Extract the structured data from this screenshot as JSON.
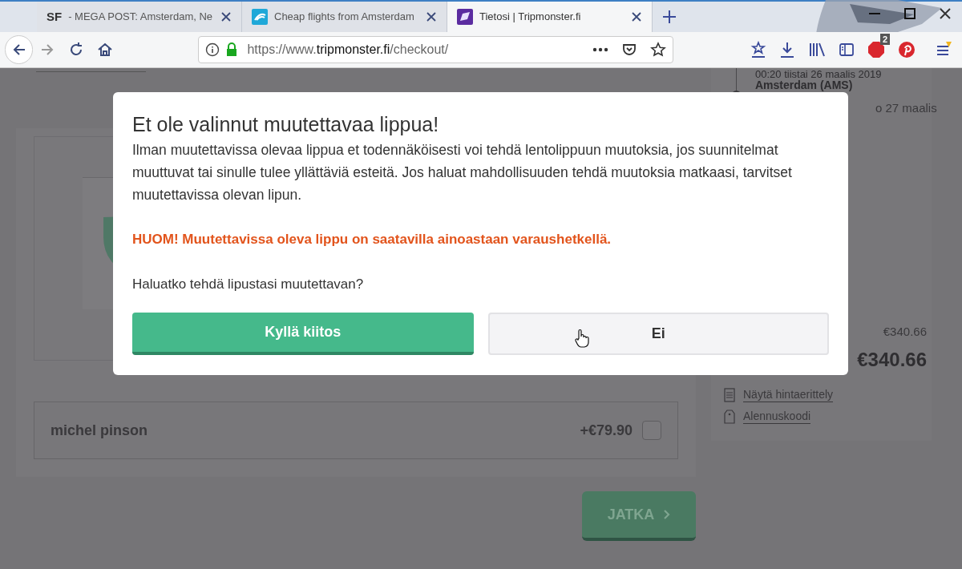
{
  "browser": {
    "tabs": [
      {
        "favicon_text": "SF",
        "title": "- MEGA POST: Amsterdam, Ne",
        "selected": false
      },
      {
        "title": "Cheap flights from Amsterdam",
        "selected": false
      },
      {
        "title": "Tietosi | Tripmonster.fi",
        "selected": true
      }
    ],
    "url": {
      "prefix": "https://www.",
      "domain": "tripmonster.fi",
      "path": "/checkout/"
    },
    "adblock_badge": "2"
  },
  "page": {
    "passenger": {
      "name": "michel pinson",
      "price": "+€79.90",
      "checked": false
    },
    "continue_button": {
      "label": "JATKA",
      "disabled": true
    },
    "sidebar": {
      "departure_time": "00:20 tiistai 26 maalis 2019",
      "airport": "Amsterdam (AMS)",
      "arrival_partial": "o 27 maalis",
      "subtotal": "€340.66",
      "total": "€340.66",
      "links": [
        "Näytä hintaerittely",
        "Alennuskoodi"
      ]
    }
  },
  "modal": {
    "title": "Et ole valinnut muutettavaa lippua!",
    "body": "Ilman muutettavissa olevaa lippua et todennäköisesti voi tehdä lentolippuun muutoksia, jos suunnitelmat muuttuvat tai sinulle tulee yllättäviä esteitä. Jos haluat mahdollisuuden tehdä muutoksia matkaasi, tarvitset muutettavissa olevan lipun.",
    "warning": "HUOM! Muutettavissa oleva lippu on saatavilla ainoastaan varaushetkellä.",
    "question": "Haluatko tehdä lipustasi muutettavan?",
    "buttons": [
      {
        "label": "Kyllä kiitos",
        "kind": "primary"
      },
      {
        "label": "Ei",
        "kind": "secondary"
      }
    ]
  }
}
